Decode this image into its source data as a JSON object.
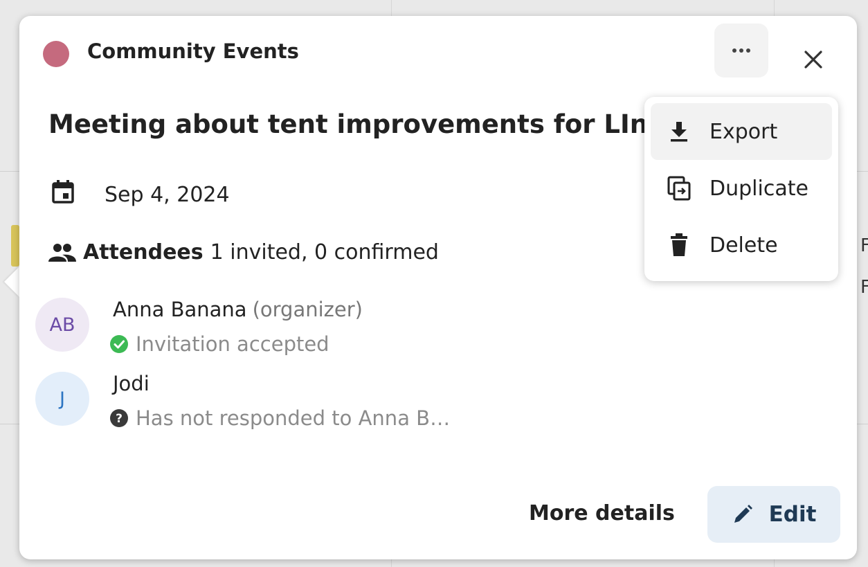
{
  "background": {
    "edge_letters": [
      "F",
      "F"
    ]
  },
  "popover": {
    "calendar_name": "Community Events",
    "calendar_color": "#c56a7e",
    "title": "Meeting about tent improvements for LIn",
    "date": "Sep 4, 2024",
    "attendees": {
      "label": "Attendees",
      "summary": "1 invited, 0 confirmed",
      "list": [
        {
          "initials": "AB",
          "name": "Anna Banana",
          "role": "(organizer)",
          "status": "Invitation accepted",
          "status_icon": "check-circle-icon"
        },
        {
          "initials": "J",
          "name": "Jodi",
          "role": "",
          "status": "Has not responded to Anna B…",
          "status_icon": "question-circle-icon"
        }
      ]
    },
    "more_details_label": "More details",
    "edit_label": "Edit"
  },
  "menu": {
    "items": [
      {
        "label": "Export",
        "icon": "download-icon"
      },
      {
        "label": "Duplicate",
        "icon": "duplicate-icon"
      },
      {
        "label": "Delete",
        "icon": "trash-icon"
      }
    ]
  }
}
